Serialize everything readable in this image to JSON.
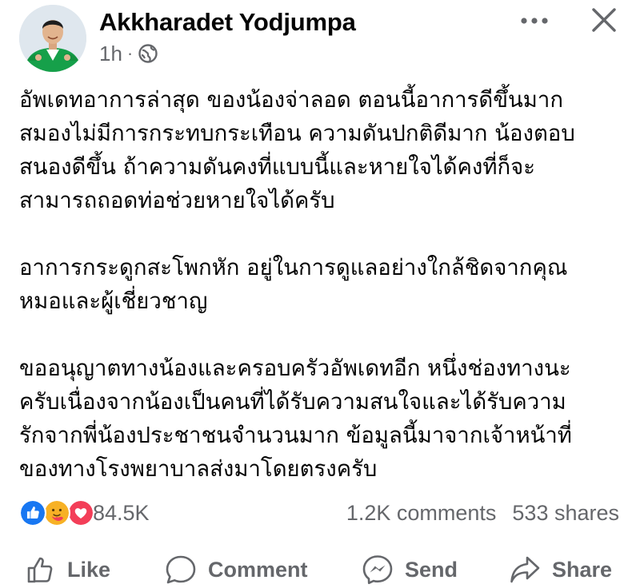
{
  "author": {
    "name": "Akkharadet Yodjumpa",
    "time": "1h",
    "separator": "·"
  },
  "icons": {
    "privacy": "globe-icon",
    "more": "more-options-icon",
    "close": "close-icon"
  },
  "post": {
    "paragraphs": [
      {
        "lines": [
          "อัพเดทอาการล่าสุด ของน้องจ่าลอด ตอนนี้อาการดีขึ้นมาก",
          "สมองไม่มีการกระทบกระเทือน ความดันปกติดีมาก น้องตอบ",
          "สนองดีขึ้น ถ้าความดันคงที่แบบนี้และหายใจได้คงที่ก็จะ",
          "สามารถถอดท่อช่วยหายใจได้ครับ"
        ]
      },
      {
        "lines": [
          "อาการกระดูกสะโพกหัก อยู่ในการดูแลอย่างใกล้ชิดจากคุณ",
          "หมอและผู้เชี่ยวชาญ"
        ]
      },
      {
        "lines": [
          "ขออนุญาตทางน้องและครอบครัวอัพเดทอีก  หนึ่งช่องทางนะ",
          "ครับเนื่องจากน้องเป็นคนที่ได้รับความสนใจและได้รับความ",
          "รักจากพี่น้องประชาชนจำนวนมาก ข้อมูลนี้มาจากเจ้าหน้าที่",
          "ของทางโรงพยาบาลส่งมาโดยตรงครับ"
        ]
      }
    ]
  },
  "engagement": {
    "reactions": [
      "like",
      "care",
      "love"
    ],
    "reaction_count": "84.5K",
    "comments": "1.2K comments",
    "shares": "533 shares"
  },
  "colors": {
    "like_blue": "#1877f2",
    "love_red": "#f33e58",
    "care_yellow": "#f7b125",
    "secondary_text": "#65676b",
    "primary_text": "#050505"
  },
  "actions": {
    "like": "Like",
    "comment": "Comment",
    "send": "Send",
    "share": "Share"
  }
}
